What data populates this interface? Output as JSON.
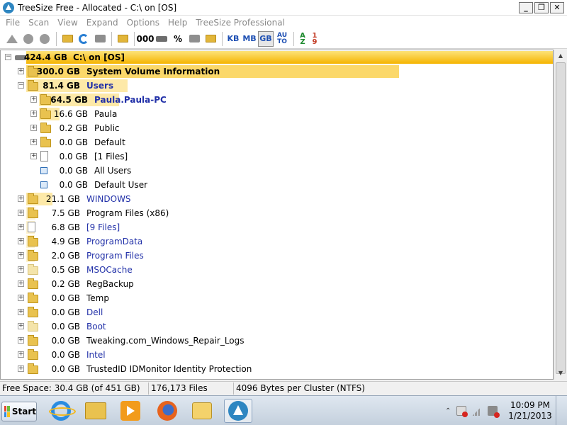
{
  "window": {
    "title": "TreeSize Free - Allocated - C:\\  on  [OS]"
  },
  "menu": [
    "File",
    "Scan",
    "View",
    "Expand",
    "Options",
    "Help",
    "TreeSize Professional"
  ],
  "toolbar": {
    "units": [
      "KB",
      "MB",
      "GB"
    ],
    "active_unit": "GB",
    "auto_label": "AU TO",
    "percent_label": "%",
    "count_label": "000",
    "sort_az": "A Z",
    "sort_19": "1 9"
  },
  "tree": {
    "root": {
      "size": "424.4 GB",
      "name": "C:\\  on  [OS]"
    },
    "rows": [
      {
        "size": "300.0 GB",
        "name": "System Volume Information",
        "fraction": 0.707,
        "bold": true,
        "blue": false,
        "icon": "folder",
        "level": 1
      },
      {
        "size": "81.4 GB",
        "name": "Users",
        "fraction": 0.192,
        "bold": true,
        "blue": true,
        "icon": "folder",
        "level": 1
      },
      {
        "size": "64.5 GB",
        "name": "Paula.Paula-PC",
        "fraction": 0.152,
        "bold": true,
        "blue": true,
        "icon": "folder",
        "level": 2
      },
      {
        "size": "16.6 GB",
        "name": "Paula",
        "fraction": 0.039,
        "bold": false,
        "blue": false,
        "icon": "folder",
        "level": 2
      },
      {
        "size": "0.2 GB",
        "name": "Public",
        "fraction": 0.0,
        "bold": false,
        "blue": false,
        "icon": "folder",
        "level": 2
      },
      {
        "size": "0.0 GB",
        "name": "Default",
        "fraction": 0.0,
        "bold": false,
        "blue": false,
        "icon": "folder",
        "level": 2
      },
      {
        "size": "0.0 GB",
        "name": "[1 Files]",
        "fraction": 0.0,
        "bold": false,
        "blue": false,
        "icon": "file",
        "level": 2
      },
      {
        "size": "0.0 GB",
        "name": "All Users",
        "fraction": 0.0,
        "bold": false,
        "blue": false,
        "icon": "link",
        "level": 2
      },
      {
        "size": "0.0 GB",
        "name": "Default User",
        "fraction": 0.0,
        "bold": false,
        "blue": false,
        "icon": "link",
        "level": 2
      },
      {
        "size": "21.1 GB",
        "name": "WINDOWS",
        "fraction": 0.05,
        "bold": false,
        "blue": true,
        "icon": "folder",
        "level": 1
      },
      {
        "size": "7.5 GB",
        "name": "Program Files (x86)",
        "fraction": 0.018,
        "bold": false,
        "blue": false,
        "icon": "folder",
        "level": 1
      },
      {
        "size": "6.8 GB",
        "name": "[9 Files]",
        "fraction": 0.016,
        "bold": false,
        "blue": true,
        "icon": "file",
        "level": 1
      },
      {
        "size": "4.9 GB",
        "name": "ProgramData",
        "fraction": 0.012,
        "bold": false,
        "blue": true,
        "icon": "folder",
        "level": 1
      },
      {
        "size": "2.0 GB",
        "name": "Program Files",
        "fraction": 0.005,
        "bold": false,
        "blue": true,
        "icon": "folder",
        "level": 1
      },
      {
        "size": "0.5 GB",
        "name": "MSOCache",
        "fraction": 0.0,
        "bold": false,
        "blue": true,
        "icon": "folder-light",
        "level": 1
      },
      {
        "size": "0.2 GB",
        "name": "RegBackup",
        "fraction": 0.0,
        "bold": false,
        "blue": false,
        "icon": "folder",
        "level": 1
      },
      {
        "size": "0.0 GB",
        "name": "Temp",
        "fraction": 0.0,
        "bold": false,
        "blue": false,
        "icon": "folder",
        "level": 1
      },
      {
        "size": "0.0 GB",
        "name": "Dell",
        "fraction": 0.0,
        "bold": false,
        "blue": true,
        "icon": "folder",
        "level": 1
      },
      {
        "size": "0.0 GB",
        "name": "Boot",
        "fraction": 0.0,
        "bold": false,
        "blue": true,
        "icon": "folder-light",
        "level": 1
      },
      {
        "size": "0.0 GB",
        "name": "Tweaking.com_Windows_Repair_Logs",
        "fraction": 0.0,
        "bold": false,
        "blue": false,
        "icon": "folder",
        "level": 1
      },
      {
        "size": "0.0 GB",
        "name": "Intel",
        "fraction": 0.0,
        "bold": false,
        "blue": true,
        "icon": "folder",
        "level": 1
      },
      {
        "size": "0.0 GB",
        "name": "TrustedID IDMonitor Identity Protection",
        "fraction": 0.0,
        "bold": false,
        "blue": false,
        "icon": "folder",
        "level": 1
      }
    ]
  },
  "status": {
    "free_space": "Free Space: 30.4 GB  (of 451 GB)",
    "files": "176,173  Files",
    "cluster": "4096 Bytes per Cluster (NTFS)"
  },
  "taskbar": {
    "start_label": "Start",
    "apps": [
      "internet-explorer-icon",
      "windows-explorer-icon",
      "media-player-icon",
      "firefox-icon",
      "outlook-icon",
      "treesize-icon"
    ],
    "active_app": "treesize-icon",
    "clock_time": "10:09 PM",
    "clock_date": "1/21/2013"
  },
  "colors": {
    "bar_strong": "#f7c10f",
    "bar_mid": "#fbd86a",
    "bar_light": "#fde9a8",
    "bar_faint": "#fef3cf",
    "text_blue": "#2130a8"
  }
}
